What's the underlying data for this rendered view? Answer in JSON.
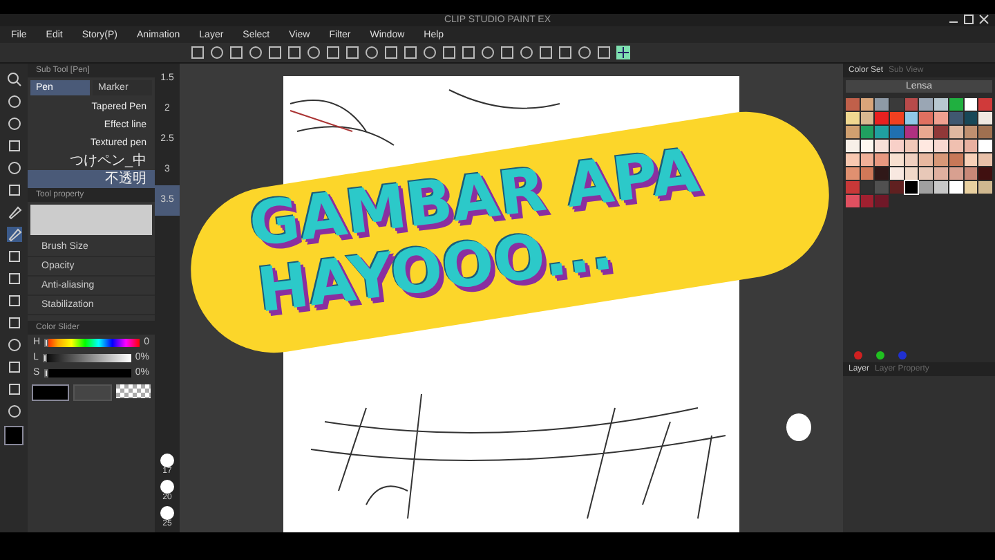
{
  "window": {
    "title": "CLIP STUDIO PAINT EX"
  },
  "menu": [
    "File",
    "Edit",
    "Story(P)",
    "Animation",
    "Layer",
    "Select",
    "View",
    "Filter",
    "Window",
    "Help"
  ],
  "sub_tool": {
    "title": "Sub Tool [Pen]",
    "tabs": [
      {
        "label": "Pen",
        "selected": true
      },
      {
        "label": "Marker",
        "selected": false
      }
    ],
    "brushes": [
      {
        "label": "Tapered Pen",
        "selected": false
      },
      {
        "label": "Effect line",
        "selected": false
      },
      {
        "label": "Textured pen",
        "selected": false
      },
      {
        "label": "つけペン_中",
        "selected": false
      },
      {
        "label": "不透明",
        "selected": true
      }
    ]
  },
  "sizes": [
    {
      "label": "1.5",
      "selected": false
    },
    {
      "label": "2",
      "selected": false
    },
    {
      "label": "2.5",
      "selected": false
    },
    {
      "label": "3",
      "selected": false
    },
    {
      "label": "3.5",
      "selected": true
    }
  ],
  "tool_property": {
    "title": "Tool property",
    "rows": [
      "Brush Size",
      "Opacity",
      "Anti-aliasing",
      "Stabilization"
    ]
  },
  "color_slider": {
    "title": "Color Slider",
    "rows": [
      {
        "label": "H",
        "reading": "0",
        "level": 0
      },
      {
        "label": "L",
        "reading": "0%",
        "level": 0
      },
      {
        "label": "S",
        "reading": "0%",
        "level": 0
      }
    ]
  },
  "brush_sizes": [
    "17",
    "20",
    "25"
  ],
  "color_set": {
    "tabs": [
      {
        "label": "Color Set",
        "selected": true
      },
      {
        "label": "Sub View",
        "selected": false
      }
    ],
    "palette": "Lensa",
    "swatches": [
      {
        "color": "#c0604a",
        "selected": false
      },
      {
        "color": "#d9a57a",
        "selected": false
      },
      {
        "color": "#8e9aa6",
        "selected": false
      },
      {
        "color": "#3a3a3a",
        "selected": false
      },
      {
        "color": "#b84a4a",
        "selected": false
      },
      {
        "color": "#9aa6b4",
        "selected": false
      },
      {
        "color": "#b8c8d0",
        "selected": false
      },
      {
        "color": "#20b040",
        "selected": false
      },
      {
        "color": "#ffffff",
        "selected": false
      },
      {
        "color": "#d03a3a",
        "selected": false
      },
      {
        "color": "#f0d890",
        "selected": false
      },
      {
        "color": "#d8b890",
        "selected": false
      },
      {
        "color": "#e82020",
        "selected": false
      },
      {
        "color": "#f04020",
        "selected": false
      },
      {
        "color": "#90c8e8",
        "selected": false
      },
      {
        "color": "#e07060",
        "selected": false
      },
      {
        "color": "#f0a090",
        "selected": false
      },
      {
        "color": "#405870",
        "selected": false
      },
      {
        "color": "#184858",
        "selected": false
      },
      {
        "color": "#f0e8e0",
        "selected": false
      },
      {
        "color": "#d0a070",
        "selected": false
      },
      {
        "color": "#20a060",
        "selected": false
      },
      {
        "color": "#20a0a0",
        "selected": false
      },
      {
        "color": "#2070b0",
        "selected": false
      },
      {
        "color": "#b03080",
        "selected": false
      },
      {
        "color": "#e8a890",
        "selected": false
      },
      {
        "color": "#903838",
        "selected": false
      },
      {
        "color": "#e0b8a0",
        "selected": false
      },
      {
        "color": "#c09070",
        "selected": false
      },
      {
        "color": "#a07050",
        "selected": false
      },
      {
        "color": "#f8f0e8",
        "selected": false
      },
      {
        "color": "#fff8f0",
        "selected": false
      },
      {
        "color": "#f8e0d8",
        "selected": false
      },
      {
        "color": "#f8d0c8",
        "selected": false
      },
      {
        "color": "#f0c8b8",
        "selected": false
      },
      {
        "color": "#ffe8e0",
        "selected": false
      },
      {
        "color": "#f8d8d0",
        "selected": false
      },
      {
        "color": "#f0c0b0",
        "selected": false
      },
      {
        "color": "#e8b0a0",
        "selected": false
      },
      {
        "color": "#ffffff",
        "selected": false
      },
      {
        "color": "#f8c8b0",
        "selected": false
      },
      {
        "color": "#f0b098",
        "selected": false
      },
      {
        "color": "#e89880",
        "selected": false
      },
      {
        "color": "#f8e0d0",
        "selected": false
      },
      {
        "color": "#f0d0c0",
        "selected": false
      },
      {
        "color": "#e8b8a0",
        "selected": false
      },
      {
        "color": "#d89878",
        "selected": false
      },
      {
        "color": "#c87858",
        "selected": false
      },
      {
        "color": "#f8d0b8",
        "selected": false
      },
      {
        "color": "#e8c0a8",
        "selected": false
      },
      {
        "color": "#e09070",
        "selected": false
      },
      {
        "color": "#d07858",
        "selected": false
      },
      {
        "color": "#301818",
        "selected": false
      },
      {
        "color": "#f8e8e0",
        "selected": false
      },
      {
        "color": "#f0d8c8",
        "selected": false
      },
      {
        "color": "#e8c8b8",
        "selected": false
      },
      {
        "color": "#e0b0a0",
        "selected": false
      },
      {
        "color": "#d8a090",
        "selected": false
      },
      {
        "color": "#c88878",
        "selected": false
      },
      {
        "color": "#401010",
        "selected": false
      },
      {
        "color": "#c83838",
        "selected": false
      },
      {
        "color": "#303030",
        "selected": false
      },
      {
        "color": "#505050",
        "selected": false
      },
      {
        "color": "#602020",
        "selected": false
      },
      {
        "color": "#000000",
        "selected": true
      },
      {
        "color": "#a0a0a0",
        "selected": false
      },
      {
        "color": "#c8c8c8",
        "selected": false
      },
      {
        "color": "#ffffff",
        "selected": false
      },
      {
        "color": "#e8d0a0",
        "selected": false
      },
      {
        "color": "#d0b890",
        "selected": false
      },
      {
        "color": "#e05060",
        "selected": false
      },
      {
        "color": "#a02030",
        "selected": false
      },
      {
        "color": "#701828",
        "selected": false
      }
    ]
  },
  "layer_panel": {
    "tabs": [
      {
        "label": "Layer",
        "selected": true
      },
      {
        "label": "Layer Property",
        "selected": false
      }
    ]
  },
  "banner": {
    "lines": [
      "GAMBAR APA",
      "HAYOOO..."
    ]
  }
}
